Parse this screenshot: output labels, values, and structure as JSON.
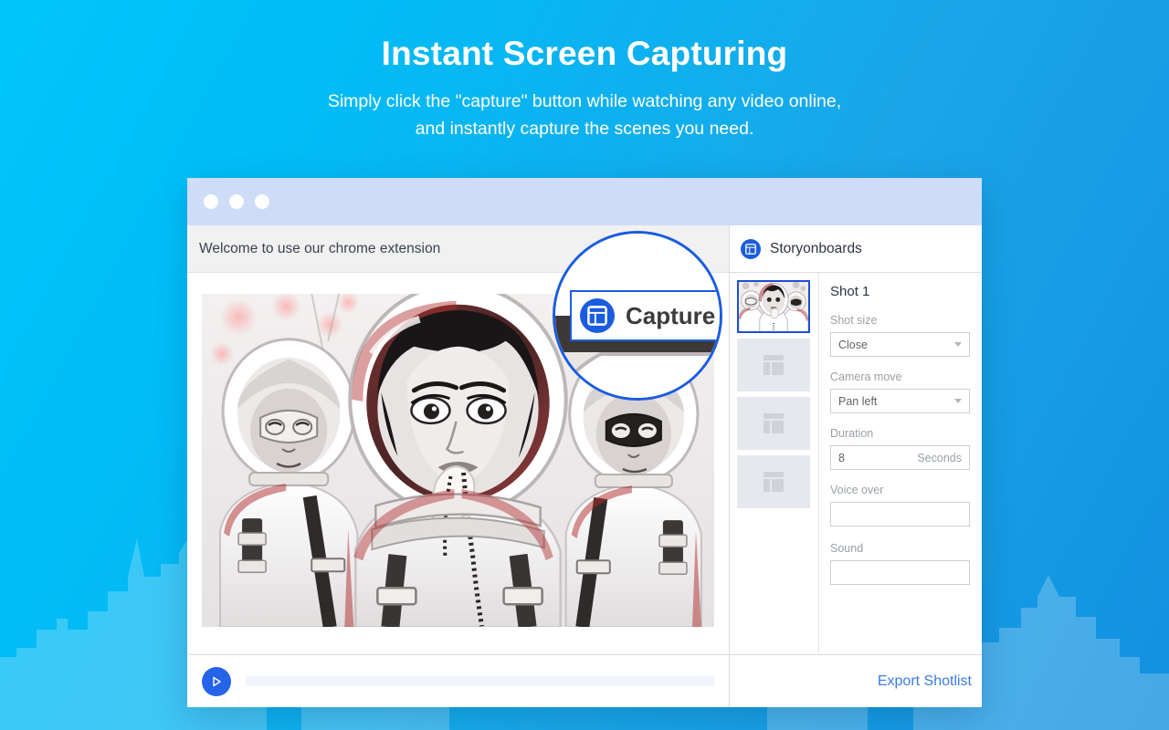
{
  "hero": {
    "title": "Instant Screen Capturing",
    "subtitle_line1": "Simply click the \"capture\" button while watching any video online,",
    "subtitle_line2": "and instantly capture the scenes you need."
  },
  "window": {
    "traffic_lights": [
      "close-dot",
      "minimize-dot",
      "maximize-dot"
    ],
    "welcome_text": "Welcome to use our chrome extension",
    "capture_button_label": "Capture",
    "magnified_capture_label": "Capture"
  },
  "panel": {
    "title": "Storyonboards",
    "shot_title": "Shot 1",
    "thumbnails": [
      {
        "name": "thumbnail-shot-1",
        "selected": true,
        "empty": false
      },
      {
        "name": "thumbnail-shot-2",
        "selected": false,
        "empty": true
      },
      {
        "name": "thumbnail-shot-3",
        "selected": false,
        "empty": true
      },
      {
        "name": "thumbnail-shot-4",
        "selected": false,
        "empty": true
      }
    ],
    "fields": [
      {
        "label": "Shot size",
        "value": "Close",
        "suffix": "",
        "type": "select"
      },
      {
        "label": "Camera move",
        "value": "Pan left",
        "suffix": "",
        "type": "select"
      },
      {
        "label": "Duration",
        "value": "8",
        "suffix": "Seconds",
        "type": "number"
      },
      {
        "label": "Voice over",
        "value": "",
        "suffix": "",
        "type": "text"
      },
      {
        "label": "Sound",
        "value": "",
        "suffix": "",
        "type": "text"
      }
    ],
    "export_label": "Export Shotlist"
  },
  "colors": {
    "bg_gradient_start": "#00c6fb",
    "bg_gradient_end": "#1290e0",
    "titlebar": "#cfdcf7",
    "accent_blue": "#1a5ce0",
    "link_blue": "#3b7ae4",
    "play_blue": "#2563e8",
    "selected_border": "#1d4ed8"
  }
}
